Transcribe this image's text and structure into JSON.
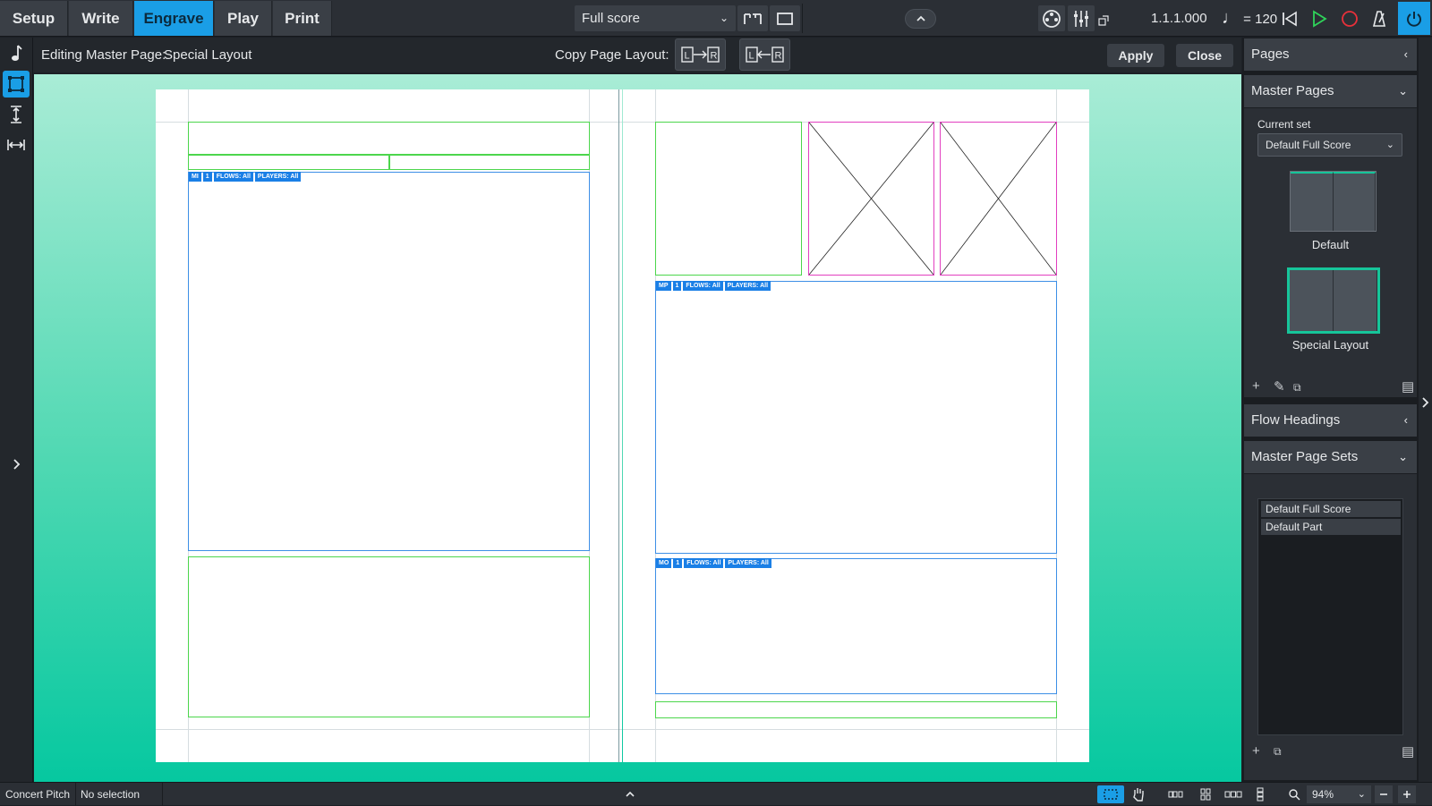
{
  "modes": [
    "Setup",
    "Write",
    "Engrave",
    "Play",
    "Print"
  ],
  "active_mode": "Engrave",
  "layout_select": "Full score",
  "position": "1.1.1.000",
  "tempo": "= 120",
  "subbar": {
    "editing_label": "Editing Master Page:",
    "editing_name": "Special Layout",
    "copy_label": "Copy Page Layout:",
    "copy_lr": "L→R",
    "copy_rl": "L←R",
    "apply": "Apply",
    "close": "Close"
  },
  "frame_chips": {
    "left_music": [
      "MI",
      "1",
      "FLOWS: All",
      "PLAYERS: All"
    ],
    "right_music_1": [
      "MP",
      "1",
      "FLOWS: All",
      "PLAYERS: All"
    ],
    "right_music_2": [
      "MO",
      "1",
      "FLOWS: All",
      "PLAYERS: All"
    ]
  },
  "panel": {
    "pages": "Pages",
    "master_pages": "Master Pages",
    "current_set_label": "Current set",
    "current_set": "Default Full Score",
    "thumb_default": "Default",
    "thumb_special": "Special Layout",
    "flow_headings": "Flow Headings",
    "master_page_sets": "Master Page Sets",
    "sets": [
      "Default Full Score",
      "Default Part"
    ]
  },
  "status": {
    "concert_pitch": "Concert Pitch",
    "selection": "No selection",
    "zoom": "94%"
  },
  "colors": {
    "accent": "#1a9ee6",
    "text_frame": "#4cd64c",
    "music_frame": "#3d8fe6",
    "graphic_frame": "#e23fc0",
    "selected_thumb": "#16c59a"
  }
}
